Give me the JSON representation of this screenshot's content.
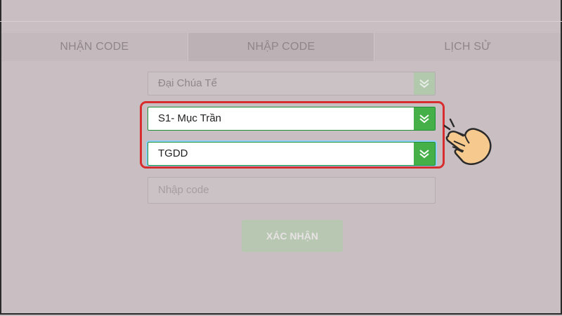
{
  "tabs": [
    {
      "label": "NHẬN CODE"
    },
    {
      "label": "NHẬP CODE"
    },
    {
      "label": "LỊCH SỬ"
    }
  ],
  "form": {
    "game_value": "Đại Chúa Tể",
    "server_value": "S1- Mục Trần",
    "source_value": "TGDD",
    "code_placeholder": "Nhập code",
    "confirm_label": "XÁC NHẬN"
  },
  "colors": {
    "background": "#c9bfc3",
    "highlight": "#d62e2e",
    "accent_green": "#45b048"
  }
}
